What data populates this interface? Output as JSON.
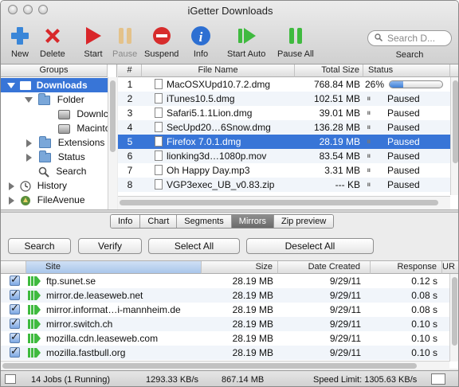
{
  "window": {
    "title": "iGetter Downloads"
  },
  "toolbar": {
    "new": "New",
    "delete": "Delete",
    "start": "Start",
    "pause": "Pause",
    "suspend": "Suspend",
    "info": "Info",
    "start_auto": "Start Auto",
    "pause_all": "Pause All",
    "search_placeholder": "Search D...",
    "search_label": "Search"
  },
  "sidebar": {
    "header": "Groups",
    "items": [
      {
        "label": "Downloads"
      },
      {
        "label": "Folder"
      },
      {
        "label": "Downlc"
      },
      {
        "label": "Macintc"
      },
      {
        "label": "Extensions"
      },
      {
        "label": "Status"
      },
      {
        "label": "Search"
      },
      {
        "label": "History"
      },
      {
        "label": "FileAvenue"
      }
    ]
  },
  "downloads": {
    "columns": {
      "num": "#",
      "filename": "File Name",
      "size": "Total Size",
      "status": "Status"
    },
    "rows": [
      {
        "num": "1",
        "name": "MacOSXUpd10.7.2.dmg",
        "size": "768.84 MB",
        "status": "26%",
        "progress": 0.26
      },
      {
        "num": "2",
        "name": "iTunes10.5.dmg",
        "size": "102.51 MB",
        "status": "Paused"
      },
      {
        "num": "3",
        "name": "Safari5.1.1Lion.dmg",
        "size": "39.01 MB",
        "status": "Paused"
      },
      {
        "num": "4",
        "name": "SecUpd20…6Snow.dmg",
        "size": "136.28 MB",
        "status": "Paused"
      },
      {
        "num": "5",
        "name": "Firefox 7.0.1.dmg",
        "size": "28.19 MB",
        "status": "Paused"
      },
      {
        "num": "6",
        "name": "lionking3d…1080p.mov",
        "size": "83.54 MB",
        "status": "Paused"
      },
      {
        "num": "7",
        "name": "Oh Happy Day.mp3",
        "size": "3.31 MB",
        "status": "Paused"
      },
      {
        "num": "8",
        "name": "VGP3exec_UB_v0.83.zip",
        "size": "--- KB",
        "status": "Paused"
      }
    ],
    "pause_glyph": "⏸"
  },
  "tabs": [
    "Info",
    "Chart",
    "Segments",
    "Mirrors",
    "Zip preview"
  ],
  "actions": {
    "search": "Search",
    "verify": "Verify",
    "select_all": "Select All",
    "deselect_all": "Deselect All"
  },
  "mirrors": {
    "columns": {
      "site": "Site",
      "size": "Size",
      "date": "Date Created",
      "response": "Response",
      "ur": "UR"
    },
    "rows": [
      {
        "site": "ftp.sunet.se",
        "size": "28.19 MB",
        "date": "9/29/11",
        "response": "0.12 s"
      },
      {
        "site": "mirror.de.leaseweb.net",
        "size": "28.19 MB",
        "date": "9/29/11",
        "response": "0.08 s"
      },
      {
        "site": "mirror.informat…i-mannheim.de",
        "size": "28.19 MB",
        "date": "9/29/11",
        "response": "0.08 s"
      },
      {
        "site": "mirror.switch.ch",
        "size": "28.19 MB",
        "date": "9/29/11",
        "response": "0.10 s"
      },
      {
        "site": "mozilla.cdn.leaseweb.com",
        "size": "28.19 MB",
        "date": "9/29/11",
        "response": "0.10 s"
      },
      {
        "site": "mozilla.fastbull.org",
        "size": "28.19 MB",
        "date": "9/29/11",
        "response": "0.10 s"
      }
    ]
  },
  "status": {
    "jobs": "14 Jobs (1 Running)",
    "speed": "1293.33 KB/s",
    "transferred": "867.14 MB",
    "speed_limit": "Speed Limit: 1305.63 KB/s"
  }
}
